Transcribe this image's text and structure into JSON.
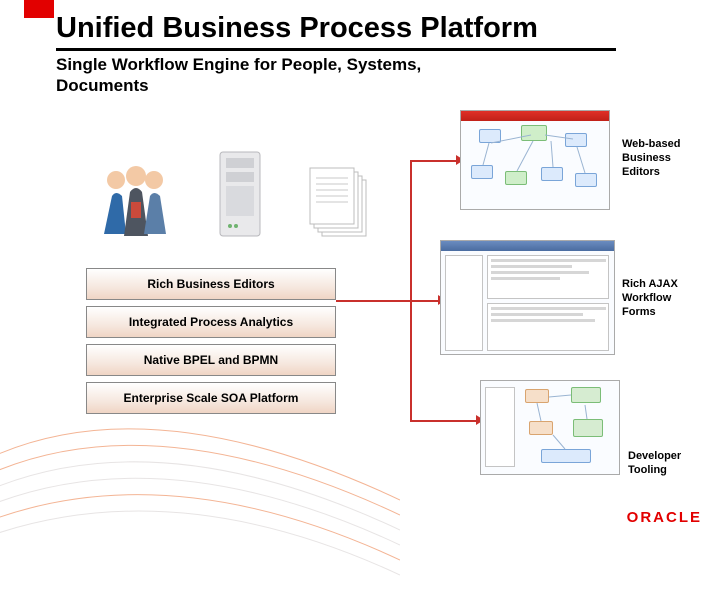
{
  "header": {
    "title": "Unified Business Process Platform",
    "subtitle": "Single Workflow Engine for People, Systems, Documents"
  },
  "stack": {
    "layers": [
      "Rich Business Editors",
      "Integrated Process Analytics",
      "Native BPEL and BPMN",
      "Enterprise Scale SOA Platform"
    ]
  },
  "shots": {
    "label1": "Web-based Business Editors",
    "label2": "Rich AJAX Workflow Forms",
    "label3": "Developer Tooling"
  },
  "icons": {
    "people": "people-icon",
    "server": "server-icon",
    "documents": "documents-icon"
  },
  "brand": "ORACLE"
}
